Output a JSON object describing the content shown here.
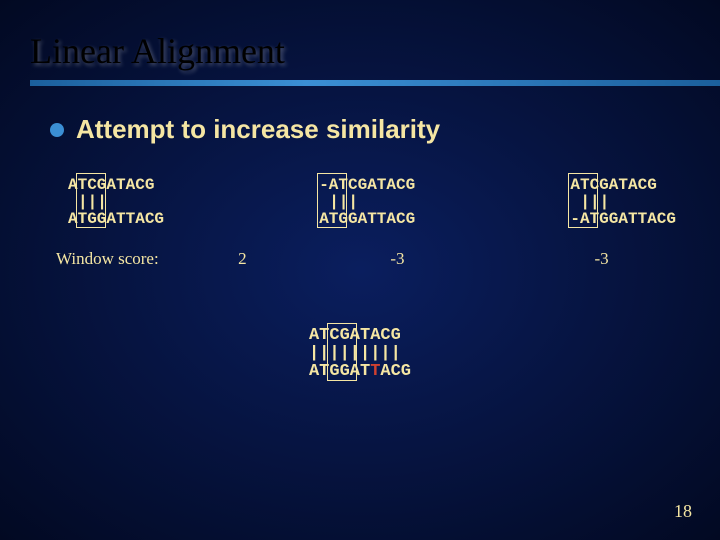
{
  "title": "Linear Alignment",
  "bullet": "Attempt to increase similarity",
  "alignments": {
    "a": {
      "top": "ATCGATACG",
      "bars": "|||",
      "bot": "ATGGATTACG"
    },
    "b": {
      "top": "-ATCGATACG",
      "bars": "|||",
      "bot": "ATGGATTACG"
    },
    "c": {
      "top": "ATCGATACG",
      "bars": "|||",
      "bot": "-ATGGATTACG"
    }
  },
  "bottom": {
    "top_black_prefix": "AT",
    "top_rest": "CGATACG",
    "bars": "|||||||||",
    "bot_black_prefix": "AT",
    "bot_mid1": "GGAT",
    "bot_red": "T",
    "bot_mid2": "ACG"
  },
  "score_label": "Window score:",
  "scores": {
    "a": "2",
    "b": "-3",
    "c": "-3"
  },
  "page_number": "18"
}
